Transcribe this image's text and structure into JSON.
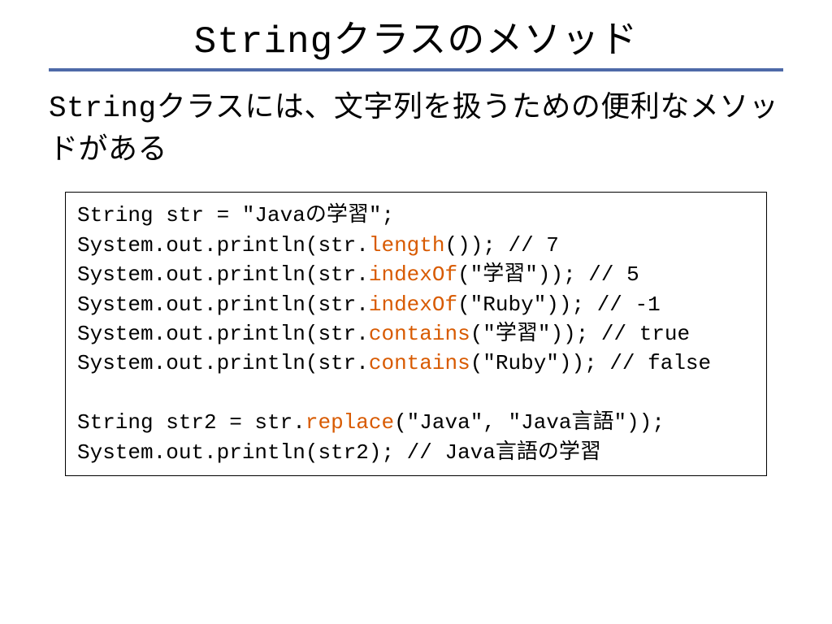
{
  "title": "Stringクラスのメソッド",
  "description": "Stringクラスには、文字列を扱うための便利なメソッドがある",
  "code": {
    "l1a": "String str = \"Javaの学習\";",
    "l2a": "System.out.println(str.",
    "l2h": "length",
    "l2b": "()); // 7",
    "l3a": "System.out.println(str.",
    "l3h": "indexOf",
    "l3b": "(\"学習\")); // 5",
    "l4a": "System.out.println(str.",
    "l4h": "indexOf",
    "l4b": "(\"Ruby\")); // -1",
    "l5a": "System.out.println(str.",
    "l5h": "contains",
    "l5b": "(\"学習\")); // true",
    "l6a": "System.out.println(str.",
    "l6h": "contains",
    "l6b": "(\"Ruby\")); // false",
    "l7a": "String str2 = str.",
    "l7h": "replace",
    "l7b": "(\"Java\", \"Java言語\"));",
    "l8a": "System.out.println(str2); // Java言語の学習"
  }
}
